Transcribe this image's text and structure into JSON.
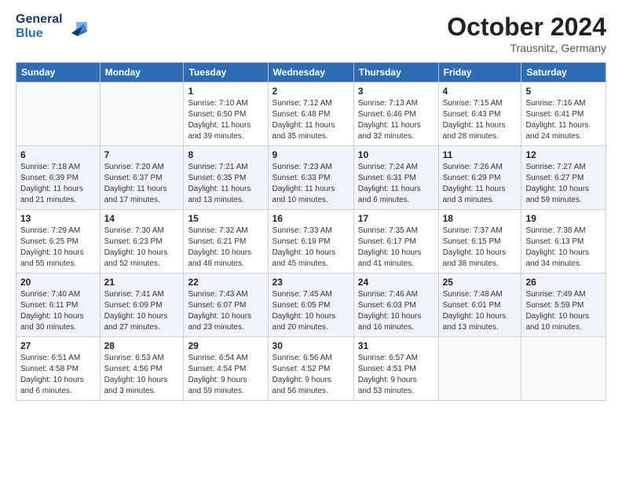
{
  "header": {
    "logo_line1": "General",
    "logo_line2": "Blue",
    "month_title": "October 2024",
    "subtitle": "Trausnitz, Germany"
  },
  "weekdays": [
    "Sunday",
    "Monday",
    "Tuesday",
    "Wednesday",
    "Thursday",
    "Friday",
    "Saturday"
  ],
  "weeks": [
    [
      {
        "num": "",
        "info": ""
      },
      {
        "num": "",
        "info": ""
      },
      {
        "num": "1",
        "info": "Sunrise: 7:10 AM\nSunset: 6:50 PM\nDaylight: 11 hours\nand 39 minutes."
      },
      {
        "num": "2",
        "info": "Sunrise: 7:12 AM\nSunset: 6:48 PM\nDaylight: 11 hours\nand 35 minutes."
      },
      {
        "num": "3",
        "info": "Sunrise: 7:13 AM\nSunset: 6:46 PM\nDaylight: 11 hours\nand 32 minutes."
      },
      {
        "num": "4",
        "info": "Sunrise: 7:15 AM\nSunset: 6:43 PM\nDaylight: 11 hours\nand 28 minutes."
      },
      {
        "num": "5",
        "info": "Sunrise: 7:16 AM\nSunset: 6:41 PM\nDaylight: 11 hours\nand 24 minutes."
      }
    ],
    [
      {
        "num": "6",
        "info": "Sunrise: 7:18 AM\nSunset: 6:39 PM\nDaylight: 11 hours\nand 21 minutes."
      },
      {
        "num": "7",
        "info": "Sunrise: 7:20 AM\nSunset: 6:37 PM\nDaylight: 11 hours\nand 17 minutes."
      },
      {
        "num": "8",
        "info": "Sunrise: 7:21 AM\nSunset: 6:35 PM\nDaylight: 11 hours\nand 13 minutes."
      },
      {
        "num": "9",
        "info": "Sunrise: 7:23 AM\nSunset: 6:33 PM\nDaylight: 11 hours\nand 10 minutes."
      },
      {
        "num": "10",
        "info": "Sunrise: 7:24 AM\nSunset: 6:31 PM\nDaylight: 11 hours\nand 6 minutes."
      },
      {
        "num": "11",
        "info": "Sunrise: 7:26 AM\nSunset: 6:29 PM\nDaylight: 11 hours\nand 3 minutes."
      },
      {
        "num": "12",
        "info": "Sunrise: 7:27 AM\nSunset: 6:27 PM\nDaylight: 10 hours\nand 59 minutes."
      }
    ],
    [
      {
        "num": "13",
        "info": "Sunrise: 7:29 AM\nSunset: 6:25 PM\nDaylight: 10 hours\nand 55 minutes."
      },
      {
        "num": "14",
        "info": "Sunrise: 7:30 AM\nSunset: 6:23 PM\nDaylight: 10 hours\nand 52 minutes."
      },
      {
        "num": "15",
        "info": "Sunrise: 7:32 AM\nSunset: 6:21 PM\nDaylight: 10 hours\nand 48 minutes."
      },
      {
        "num": "16",
        "info": "Sunrise: 7:33 AM\nSunset: 6:19 PM\nDaylight: 10 hours\nand 45 minutes."
      },
      {
        "num": "17",
        "info": "Sunrise: 7:35 AM\nSunset: 6:17 PM\nDaylight: 10 hours\nand 41 minutes."
      },
      {
        "num": "18",
        "info": "Sunrise: 7:37 AM\nSunset: 6:15 PM\nDaylight: 10 hours\nand 38 minutes."
      },
      {
        "num": "19",
        "info": "Sunrise: 7:38 AM\nSunset: 6:13 PM\nDaylight: 10 hours\nand 34 minutes."
      }
    ],
    [
      {
        "num": "20",
        "info": "Sunrise: 7:40 AM\nSunset: 6:11 PM\nDaylight: 10 hours\nand 30 minutes."
      },
      {
        "num": "21",
        "info": "Sunrise: 7:41 AM\nSunset: 6:09 PM\nDaylight: 10 hours\nand 27 minutes."
      },
      {
        "num": "22",
        "info": "Sunrise: 7:43 AM\nSunset: 6:07 PM\nDaylight: 10 hours\nand 23 minutes."
      },
      {
        "num": "23",
        "info": "Sunrise: 7:45 AM\nSunset: 6:05 PM\nDaylight: 10 hours\nand 20 minutes."
      },
      {
        "num": "24",
        "info": "Sunrise: 7:46 AM\nSunset: 6:03 PM\nDaylight: 10 hours\nand 16 minutes."
      },
      {
        "num": "25",
        "info": "Sunrise: 7:48 AM\nSunset: 6:01 PM\nDaylight: 10 hours\nand 13 minutes."
      },
      {
        "num": "26",
        "info": "Sunrise: 7:49 AM\nSunset: 5:59 PM\nDaylight: 10 hours\nand 10 minutes."
      }
    ],
    [
      {
        "num": "27",
        "info": "Sunrise: 6:51 AM\nSunset: 4:58 PM\nDaylight: 10 hours\nand 6 minutes."
      },
      {
        "num": "28",
        "info": "Sunrise: 6:53 AM\nSunset: 4:56 PM\nDaylight: 10 hours\nand 3 minutes."
      },
      {
        "num": "29",
        "info": "Sunrise: 6:54 AM\nSunset: 4:54 PM\nDaylight: 9 hours\nand 59 minutes."
      },
      {
        "num": "30",
        "info": "Sunrise: 6:56 AM\nSunset: 4:52 PM\nDaylight: 9 hours\nand 56 minutes."
      },
      {
        "num": "31",
        "info": "Sunrise: 6:57 AM\nSunset: 4:51 PM\nDaylight: 9 hours\nand 53 minutes."
      },
      {
        "num": "",
        "info": ""
      },
      {
        "num": "",
        "info": ""
      }
    ]
  ]
}
